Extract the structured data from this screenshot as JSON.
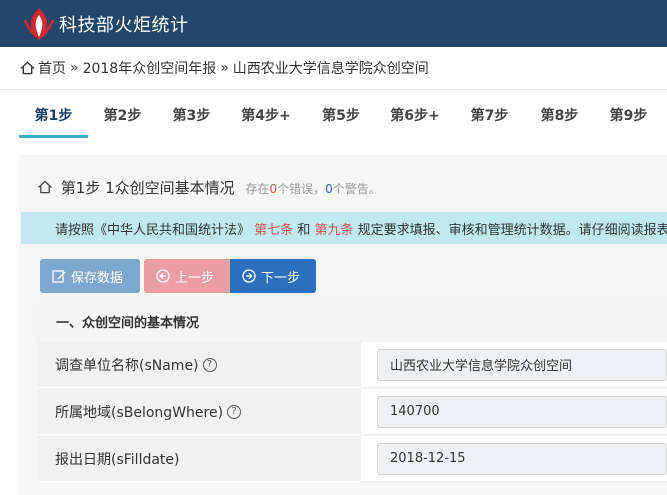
{
  "header": {
    "title": "科技部火炬统计"
  },
  "breadcrumb": {
    "items": [
      "首页",
      "2018年众创空间年报",
      "山西农业大学信息学院众创空间"
    ],
    "separator": "»"
  },
  "steps": [
    {
      "label": "第1步",
      "active": true
    },
    {
      "label": "第2步"
    },
    {
      "label": "第3步"
    },
    {
      "label": "第4步+"
    },
    {
      "label": "第5步"
    },
    {
      "label": "第6步+"
    },
    {
      "label": "第7步"
    },
    {
      "label": "第8步"
    },
    {
      "label": "第9步"
    }
  ],
  "panel": {
    "title": "第1步 1众创空间基本情况",
    "hint_prefix": "存在",
    "errors": "0",
    "hint_mid": "个错误，",
    "warnings": "0",
    "hint_suffix": "个警告。"
  },
  "notice": {
    "part1": "请按照《中华人民共和国统计法》",
    "red1": "第七条",
    "part2": "和",
    "red2": "第九条",
    "part3": "规定要求填报、审核和管理统计数据。请仔细阅读报表"
  },
  "buttons": {
    "save": "保存数据",
    "prev": "上一步",
    "next": "下一步"
  },
  "section": {
    "title": "一、众创空间的基本情况"
  },
  "fields": [
    {
      "label": "调查单位名称(sName)",
      "help": "?",
      "value": "山西农业大学信息学院众创空间"
    },
    {
      "label": "所属地域(sBelongWhere)",
      "help": "?",
      "value": "140700"
    },
    {
      "label": "报出日期(sFilldate)",
      "value": "2018-12-15"
    }
  ],
  "colors": {
    "topbar": "#23476a",
    "active_step_underline": "#3ab0c9",
    "notice_bg": "#bfe9ef",
    "save_btn": "#7ea7cf",
    "prev_btn": "#ea9ea3",
    "next_btn": "#2d6fbf"
  }
}
